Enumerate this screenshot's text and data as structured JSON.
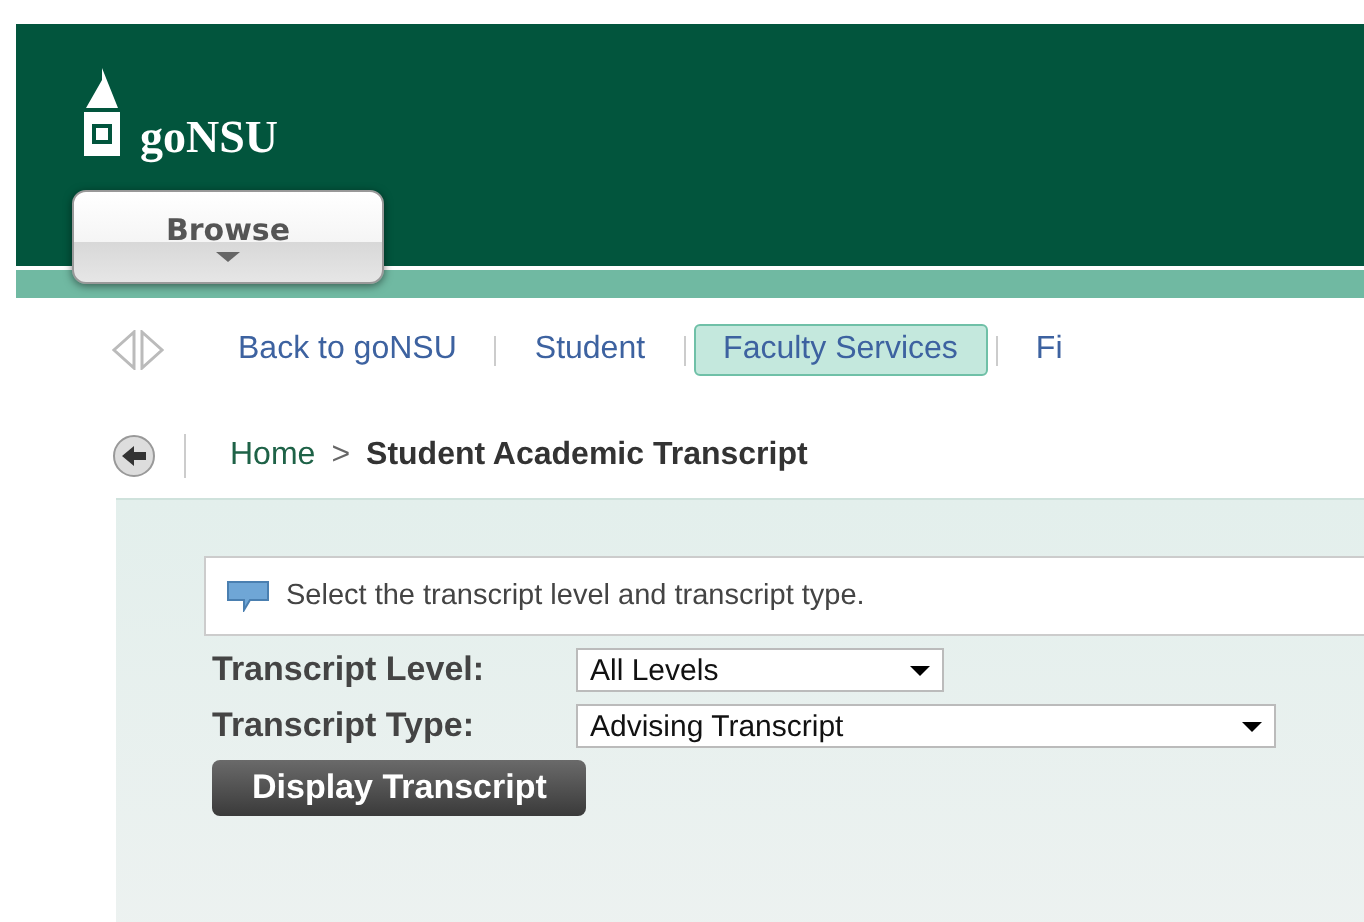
{
  "header": {
    "logo_text": "goNSU",
    "browse_button": "Browse"
  },
  "nav": {
    "tabs": [
      {
        "label": "Back to goNSU",
        "selected": false
      },
      {
        "label": "Student",
        "selected": false
      },
      {
        "label": "Faculty Services",
        "selected": true
      },
      {
        "label": "Fi",
        "selected": false
      }
    ]
  },
  "breadcrumb": {
    "home": "Home",
    "separator": ">",
    "current": "Student Academic Transcript"
  },
  "message": "Select the transcript level and transcript type.",
  "form": {
    "fields": [
      {
        "label": "Transcript Level:",
        "value": "All Levels"
      },
      {
        "label": "Transcript Type:",
        "value": "Advising Transcript"
      }
    ],
    "submit": "Display Transcript"
  }
}
